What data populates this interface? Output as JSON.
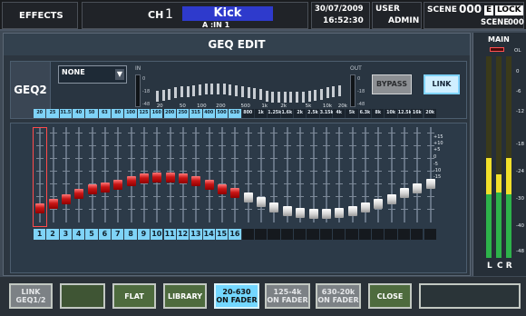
{
  "topbar": {
    "effects": "EFFECTS",
    "ch_prefix": "CH",
    "ch_num": "1",
    "ch_name": "Kick",
    "ch_sub": "A :IN 1",
    "date": "30/07/2009",
    "time": "16:52:30",
    "user_label": "USER",
    "user": "ADMIN",
    "scene_label": "SCENE",
    "scene_num": "000",
    "e_badge": "E",
    "lock": "LOCK",
    "scene_bottom": "SCENE",
    "scene_bottom_num": "000"
  },
  "main": {
    "title": "GEQ EDIT",
    "geq_label": "GEQ2",
    "library": "NONE",
    "in_label": "IN",
    "out_label": "OUT",
    "bypass": "BYPASS",
    "link": "LINK",
    "mini_scale": [
      "0",
      "-18",
      "-48"
    ],
    "graph_freqs": [
      "20",
      "50",
      "100",
      "200",
      "500",
      "1k",
      "2k",
      "5k",
      "10k",
      "20k"
    ],
    "db_scale": [
      "+15",
      "+10",
      "+5",
      "0",
      "-5",
      "-10",
      "-15"
    ]
  },
  "bands": [
    "20",
    "25",
    "31.5",
    "40",
    "50",
    "63",
    "80",
    "100",
    "125",
    "160",
    "200",
    "250",
    "315",
    "400",
    "500",
    "630",
    "800",
    "1k",
    "1.25k",
    "1.6k",
    "2k",
    "2.5k",
    "3.15k",
    "4k",
    "5k",
    "6.3k",
    "8k",
    "10k",
    "12.5k",
    "16k",
    "20k"
  ],
  "band_gains": [
    -6.5,
    -4.5,
    -2.5,
    -0.5,
    1.5,
    2.5,
    3.5,
    5,
    6,
    6.5,
    6.5,
    6,
    5,
    3.5,
    1.5,
    0,
    -2,
    -4,
    -6,
    -7.5,
    -8.5,
    -9,
    -9,
    -8.5,
    -7.5,
    -6,
    -4.5,
    -2.5,
    0,
    2,
    4
  ],
  "on_fader_count": 16,
  "fader_numbers": [
    "1",
    "2",
    "3",
    "4",
    "5",
    "6",
    "7",
    "8",
    "9",
    "10",
    "11",
    "12",
    "13",
    "14",
    "15",
    "16"
  ],
  "meter": {
    "title": "MAIN",
    "scale": [
      "OL",
      "0",
      "-6",
      "-12",
      "-18",
      "-24",
      "-30",
      "-40",
      "-48"
    ],
    "l": "L",
    "cr": "C R"
  },
  "footer": {
    "link_geq": "LINK\nGEQ1/2",
    "flat": "FLAT",
    "library": "LIBRARY",
    "f1": "20-630\nON FADER",
    "f2": "125-4k\nON FADER",
    "f3": "630-20k\nON FADER",
    "close": "CLOSE"
  },
  "colors": {
    "accent_cyan": "#73d7ff",
    "red_fader": "#c81515",
    "white_fader": "#d8d8d8",
    "meter_green": "#2db34a",
    "meter_yellow": "#f2e02a",
    "ch_name_bg": "#2e3acc"
  }
}
